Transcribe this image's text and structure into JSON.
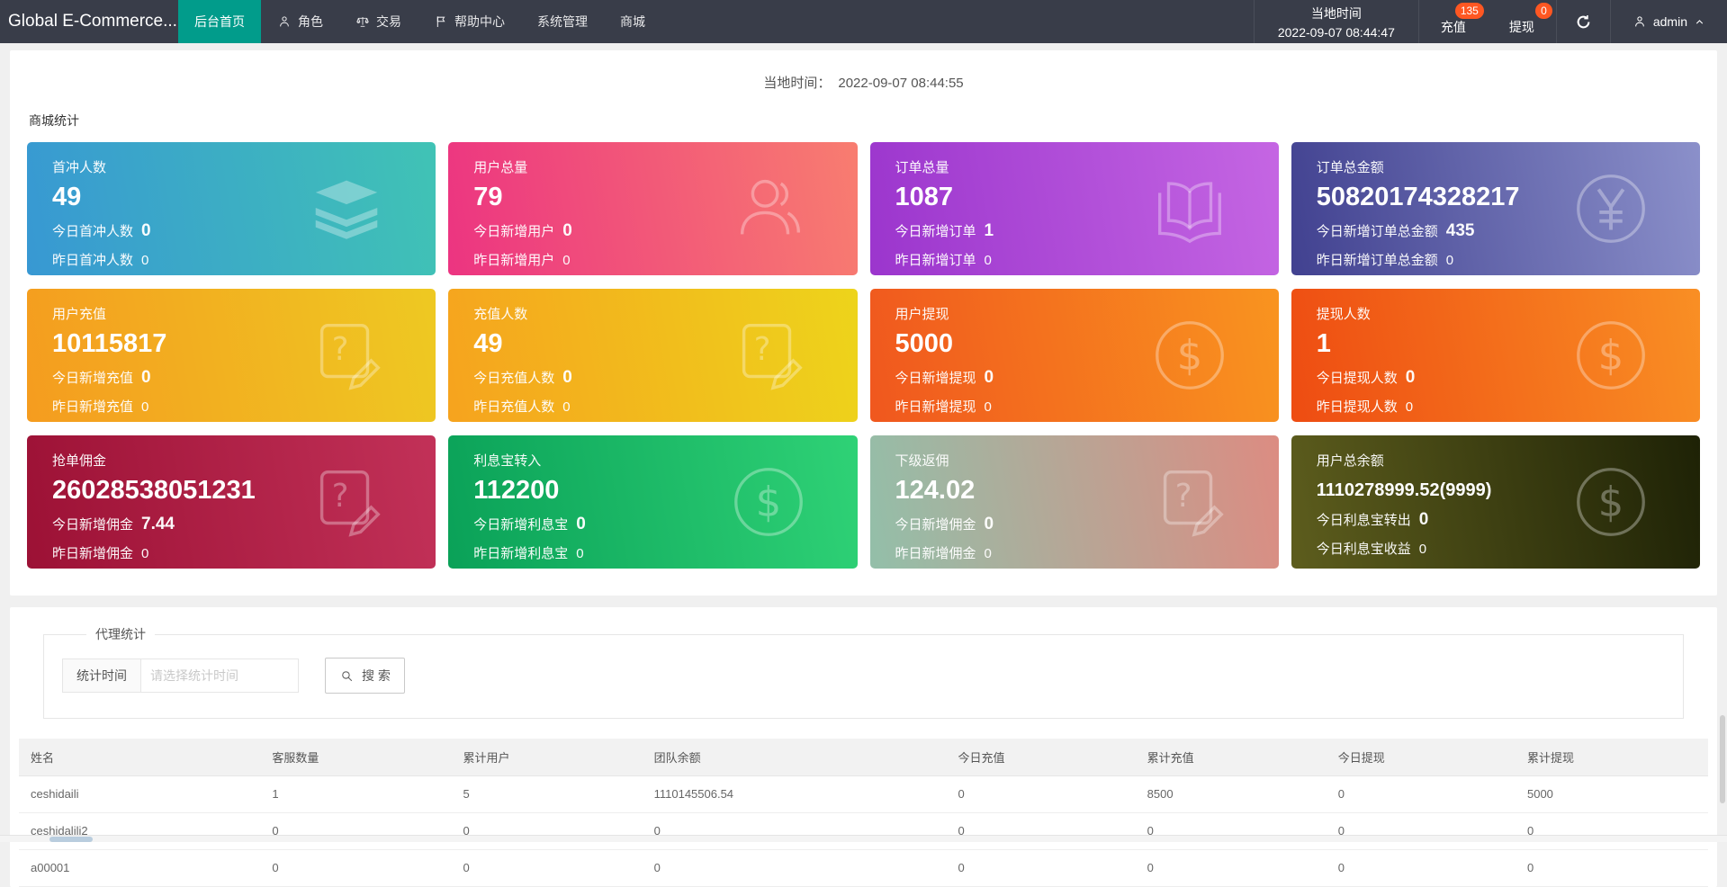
{
  "colors": {
    "navbar_bg": "#393D49",
    "active_tab": "#019C8B",
    "badge": "#FF5722"
  },
  "navbar": {
    "brand": "Global E-Commerce...",
    "tabs": [
      {
        "label": "后台首页",
        "icon": "",
        "active": true
      },
      {
        "label": "角色",
        "icon": "user",
        "active": false
      },
      {
        "label": "交易",
        "icon": "scales",
        "active": false
      },
      {
        "label": "帮助中心",
        "icon": "flag",
        "active": false
      },
      {
        "label": "系统管理",
        "icon": "",
        "active": false
      },
      {
        "label": "商城",
        "icon": "",
        "active": false
      }
    ],
    "local_time": {
      "label": "当地时间",
      "value": "2022-09-07 08:44:47"
    },
    "notices": [
      {
        "label": "充值",
        "badge": "135"
      },
      {
        "label": "提现",
        "badge": "0"
      }
    ],
    "username": "admin"
  },
  "stats_panel": {
    "local_time_label": "当地时间：",
    "local_time_value": "2022-09-07 08:44:55",
    "section_title": "商城统计",
    "cards": [
      {
        "title": "首冲人数",
        "value": "49",
        "line1_label": "今日首冲人数",
        "line1_value": "0",
        "line2_label": "昨日首冲人数",
        "line2_value": "0",
        "icon": "layers",
        "gradient": [
          "#3898d3",
          "#40c3b5"
        ]
      },
      {
        "title": "用户总量",
        "value": "79",
        "line1_label": "今日新增用户",
        "line1_value": "0",
        "line2_label": "昨日新增用户",
        "line2_value": "0",
        "icon": "users",
        "gradient": [
          "#ec3481",
          "#f87d70"
        ]
      },
      {
        "title": "订单总量",
        "value": "1087",
        "line1_label": "今日新增订单",
        "line1_value": "1",
        "line2_label": "昨日新增订单",
        "line2_value": "0",
        "icon": "book",
        "gradient": [
          "#9b35cd",
          "#c566e3"
        ]
      },
      {
        "title": "订单总金额",
        "value": "50820174328217",
        "line1_label": "今日新增订单总金额",
        "line1_value": "435",
        "line2_label": "昨日新增订单总金额",
        "line2_value": "0",
        "icon": "yen",
        "gradient": [
          "#414190",
          "#8b90ca"
        ]
      },
      {
        "title": "用户充值",
        "value": "10115817",
        "line1_label": "今日新增充值",
        "line1_value": "0",
        "line2_label": "昨日新增充值",
        "line2_value": "0",
        "icon": "question-doc",
        "gradient": [
          "#f59c1f",
          "#eec922"
        ]
      },
      {
        "title": "充值人数",
        "value": "49",
        "line1_label": "今日充值人数",
        "line1_value": "0",
        "line2_label": "昨日充值人数",
        "line2_value": "0",
        "icon": "question-doc",
        "gradient": [
          "#f6a31e",
          "#edd41b"
        ]
      },
      {
        "title": "用户提现",
        "value": "5000",
        "line1_label": "今日新增提现",
        "line1_value": "0",
        "line2_label": "昨日新增提现",
        "line2_value": "0",
        "icon": "dollar",
        "gradient": [
          "#f0571e",
          "#f9941f"
        ]
      },
      {
        "title": "提现人数",
        "value": "1",
        "line1_label": "今日提现人数",
        "line1_value": "0",
        "line2_label": "昨日提现人数",
        "line2_value": "0",
        "icon": "dollar",
        "gradient": [
          "#ee4c12",
          "#f98f24"
        ]
      },
      {
        "title": "抢单佣金",
        "value": "26028538051231",
        "line1_label": "今日新增佣金",
        "line1_value": "7.44",
        "line2_label": "昨日新增佣金",
        "line2_value": "0",
        "icon": "question-doc",
        "gradient": [
          "#9c1135",
          "#c23158"
        ]
      },
      {
        "title": "利息宝转入",
        "value": "112200",
        "line1_label": "今日新增利息宝",
        "line1_value": "0",
        "line2_label": "昨日新增利息宝",
        "line2_value": "0",
        "icon": "dollar",
        "gradient": [
          "#0aa158",
          "#2fd276"
        ]
      },
      {
        "title": "下级返佣",
        "value": "124.02",
        "line1_label": "今日新增佣金",
        "line1_value": "0",
        "line2_label": "昨日新增佣金",
        "line2_value": "0",
        "icon": "question-doc",
        "gradient": [
          "#93bfa9",
          "#dc8c82"
        ]
      },
      {
        "title": "用户总余额",
        "value": "1110278999.52(9999)",
        "small_value": true,
        "line1_label": "今日利息宝转出",
        "line1_value": "0",
        "line2_label": "今日利息宝收益",
        "line2_value": "0",
        "icon": "dollar",
        "gradient": [
          "#5d5d1d",
          "#1e2206"
        ]
      }
    ]
  },
  "agent_panel": {
    "legend": "代理统计",
    "filter_label": "统计时间",
    "filter_placeholder": "请选择统计时间",
    "search_label": "搜 索",
    "table": {
      "headers": [
        "姓名",
        "客服数量",
        "累计用户",
        "团队余额",
        "今日充值",
        "累计充值",
        "今日提现",
        "累计提现"
      ],
      "col_widths": [
        "14.3%",
        "11.3%",
        "11.3%",
        "18%",
        "11.2%",
        "11.3%",
        "11.2%",
        "11.4%"
      ],
      "rows": [
        [
          "ceshidaili",
          "1",
          "5",
          "1110145506.54",
          "0",
          "8500",
          "0",
          "5000"
        ],
        [
          "ceshidalili2",
          "0",
          "0",
          "0",
          "0",
          "0",
          "0",
          "0"
        ],
        [
          "a00001",
          "0",
          "0",
          "0",
          "0",
          "0",
          "0",
          "0"
        ]
      ]
    }
  }
}
